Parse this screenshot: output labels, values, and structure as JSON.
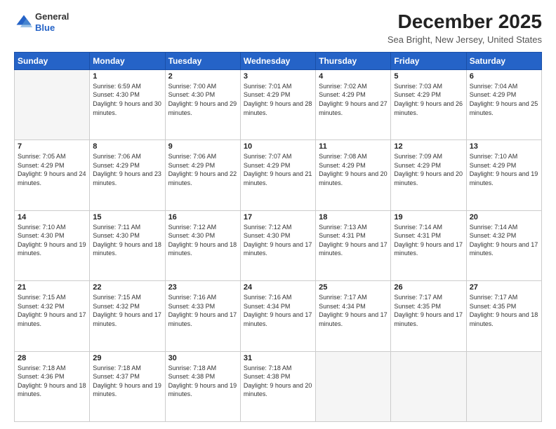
{
  "header": {
    "logo": {
      "general": "General",
      "blue": "Blue"
    },
    "title": "December 2025",
    "subtitle": "Sea Bright, New Jersey, United States"
  },
  "days_of_week": [
    "Sunday",
    "Monday",
    "Tuesday",
    "Wednesday",
    "Thursday",
    "Friday",
    "Saturday"
  ],
  "weeks": [
    [
      {
        "day": "",
        "sunrise": "",
        "sunset": "",
        "daylight": ""
      },
      {
        "day": "1",
        "sunrise": "6:59 AM",
        "sunset": "4:30 PM",
        "daylight": "9 hours and 30 minutes."
      },
      {
        "day": "2",
        "sunrise": "7:00 AM",
        "sunset": "4:30 PM",
        "daylight": "9 hours and 29 minutes."
      },
      {
        "day": "3",
        "sunrise": "7:01 AM",
        "sunset": "4:29 PM",
        "daylight": "9 hours and 28 minutes."
      },
      {
        "day": "4",
        "sunrise": "7:02 AM",
        "sunset": "4:29 PM",
        "daylight": "9 hours and 27 minutes."
      },
      {
        "day": "5",
        "sunrise": "7:03 AM",
        "sunset": "4:29 PM",
        "daylight": "9 hours and 26 minutes."
      },
      {
        "day": "6",
        "sunrise": "7:04 AM",
        "sunset": "4:29 PM",
        "daylight": "9 hours and 25 minutes."
      }
    ],
    [
      {
        "day": "7",
        "sunrise": "7:05 AM",
        "sunset": "4:29 PM",
        "daylight": "9 hours and 24 minutes."
      },
      {
        "day": "8",
        "sunrise": "7:06 AM",
        "sunset": "4:29 PM",
        "daylight": "9 hours and 23 minutes."
      },
      {
        "day": "9",
        "sunrise": "7:06 AM",
        "sunset": "4:29 PM",
        "daylight": "9 hours and 22 minutes."
      },
      {
        "day": "10",
        "sunrise": "7:07 AM",
        "sunset": "4:29 PM",
        "daylight": "9 hours and 21 minutes."
      },
      {
        "day": "11",
        "sunrise": "7:08 AM",
        "sunset": "4:29 PM",
        "daylight": "9 hours and 20 minutes."
      },
      {
        "day": "12",
        "sunrise": "7:09 AM",
        "sunset": "4:29 PM",
        "daylight": "9 hours and 20 minutes."
      },
      {
        "day": "13",
        "sunrise": "7:10 AM",
        "sunset": "4:29 PM",
        "daylight": "9 hours and 19 minutes."
      }
    ],
    [
      {
        "day": "14",
        "sunrise": "7:10 AM",
        "sunset": "4:30 PM",
        "daylight": "9 hours and 19 minutes."
      },
      {
        "day": "15",
        "sunrise": "7:11 AM",
        "sunset": "4:30 PM",
        "daylight": "9 hours and 18 minutes."
      },
      {
        "day": "16",
        "sunrise": "7:12 AM",
        "sunset": "4:30 PM",
        "daylight": "9 hours and 18 minutes."
      },
      {
        "day": "17",
        "sunrise": "7:12 AM",
        "sunset": "4:30 PM",
        "daylight": "9 hours and 17 minutes."
      },
      {
        "day": "18",
        "sunrise": "7:13 AM",
        "sunset": "4:31 PM",
        "daylight": "9 hours and 17 minutes."
      },
      {
        "day": "19",
        "sunrise": "7:14 AM",
        "sunset": "4:31 PM",
        "daylight": "9 hours and 17 minutes."
      },
      {
        "day": "20",
        "sunrise": "7:14 AM",
        "sunset": "4:32 PM",
        "daylight": "9 hours and 17 minutes."
      }
    ],
    [
      {
        "day": "21",
        "sunrise": "7:15 AM",
        "sunset": "4:32 PM",
        "daylight": "9 hours and 17 minutes."
      },
      {
        "day": "22",
        "sunrise": "7:15 AM",
        "sunset": "4:32 PM",
        "daylight": "9 hours and 17 minutes."
      },
      {
        "day": "23",
        "sunrise": "7:16 AM",
        "sunset": "4:33 PM",
        "daylight": "9 hours and 17 minutes."
      },
      {
        "day": "24",
        "sunrise": "7:16 AM",
        "sunset": "4:34 PM",
        "daylight": "9 hours and 17 minutes."
      },
      {
        "day": "25",
        "sunrise": "7:17 AM",
        "sunset": "4:34 PM",
        "daylight": "9 hours and 17 minutes."
      },
      {
        "day": "26",
        "sunrise": "7:17 AM",
        "sunset": "4:35 PM",
        "daylight": "9 hours and 17 minutes."
      },
      {
        "day": "27",
        "sunrise": "7:17 AM",
        "sunset": "4:35 PM",
        "daylight": "9 hours and 18 minutes."
      }
    ],
    [
      {
        "day": "28",
        "sunrise": "7:18 AM",
        "sunset": "4:36 PM",
        "daylight": "9 hours and 18 minutes."
      },
      {
        "day": "29",
        "sunrise": "7:18 AM",
        "sunset": "4:37 PM",
        "daylight": "9 hours and 19 minutes."
      },
      {
        "day": "30",
        "sunrise": "7:18 AM",
        "sunset": "4:38 PM",
        "daylight": "9 hours and 19 minutes."
      },
      {
        "day": "31",
        "sunrise": "7:18 AM",
        "sunset": "4:38 PM",
        "daylight": "9 hours and 20 minutes."
      },
      {
        "day": "",
        "sunrise": "",
        "sunset": "",
        "daylight": ""
      },
      {
        "day": "",
        "sunrise": "",
        "sunset": "",
        "daylight": ""
      },
      {
        "day": "",
        "sunrise": "",
        "sunset": "",
        "daylight": ""
      }
    ]
  ],
  "labels": {
    "sunrise": "Sunrise:",
    "sunset": "Sunset:",
    "daylight": "Daylight:"
  }
}
